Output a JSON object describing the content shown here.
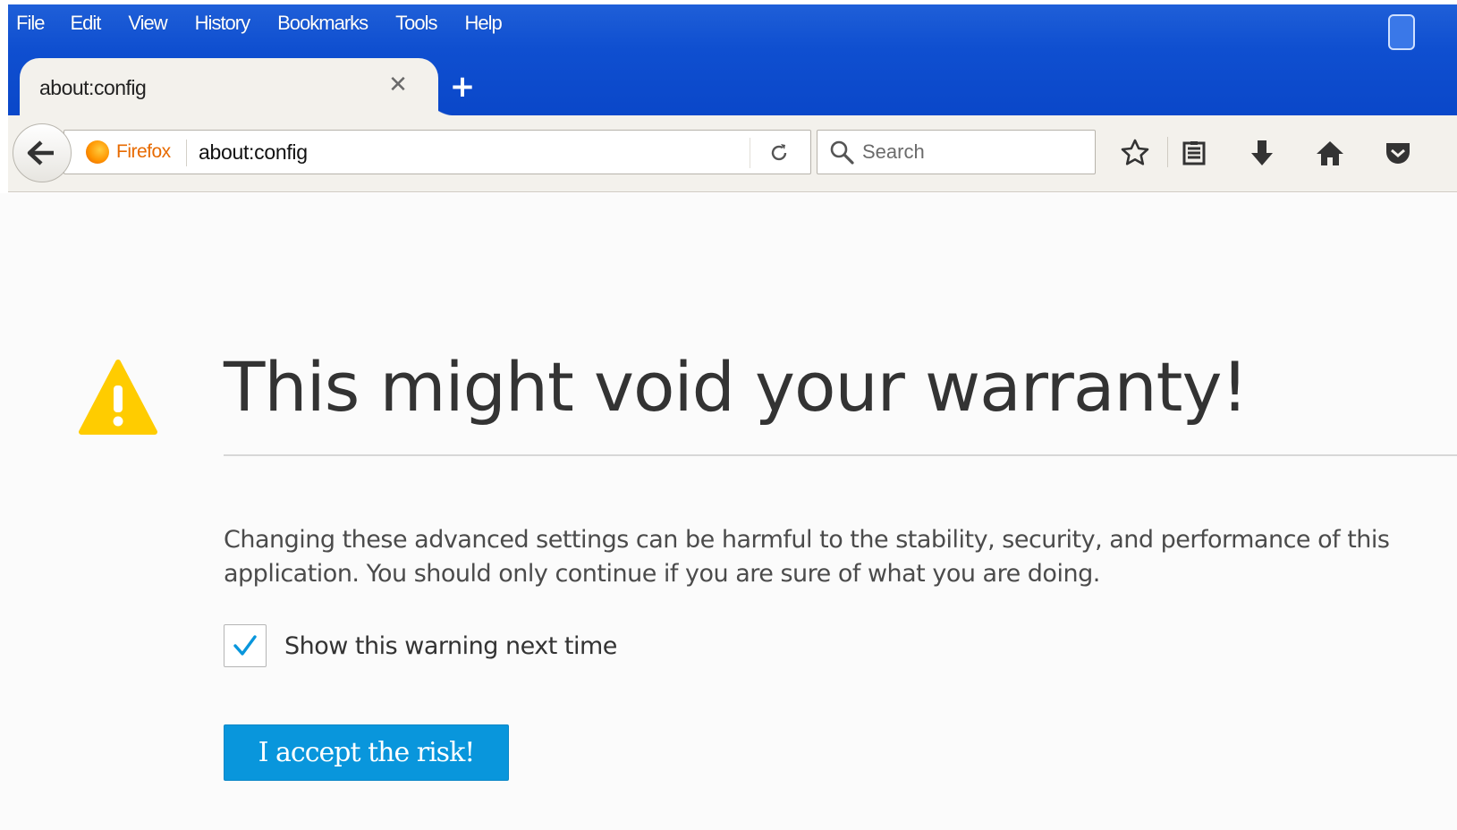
{
  "colors": {
    "titlebar": "#0f4fd0",
    "firefox_label": "#e76a00",
    "warning": "#ffcc00",
    "check": "#0996dc",
    "primary_button": "#0996dc"
  },
  "menu": {
    "items": [
      "File",
      "Edit",
      "View",
      "History",
      "Bookmarks",
      "Tools",
      "Help"
    ]
  },
  "tab": {
    "title": "about:config",
    "close_icon": "close-icon",
    "new_tab_icon": "plus-icon"
  },
  "navbar": {
    "back_icon": "back-arrow-icon",
    "identity_label": "Firefox",
    "url": "about:config",
    "reload_icon": "reload-icon",
    "search_placeholder": "Search",
    "toolbar_icons": [
      "star-icon",
      "reading-list-icon",
      "download-icon",
      "home-icon",
      "pocket-icon"
    ]
  },
  "page": {
    "heading": "This might void your warranty!",
    "description": "Changing these advanced settings can be harmful to the stability, security, and performance of this application. You should only continue if you are sure of what you are doing.",
    "checkbox_label": "Show this warning next time",
    "checkbox_checked": true,
    "accept_button": "I accept the risk!"
  }
}
